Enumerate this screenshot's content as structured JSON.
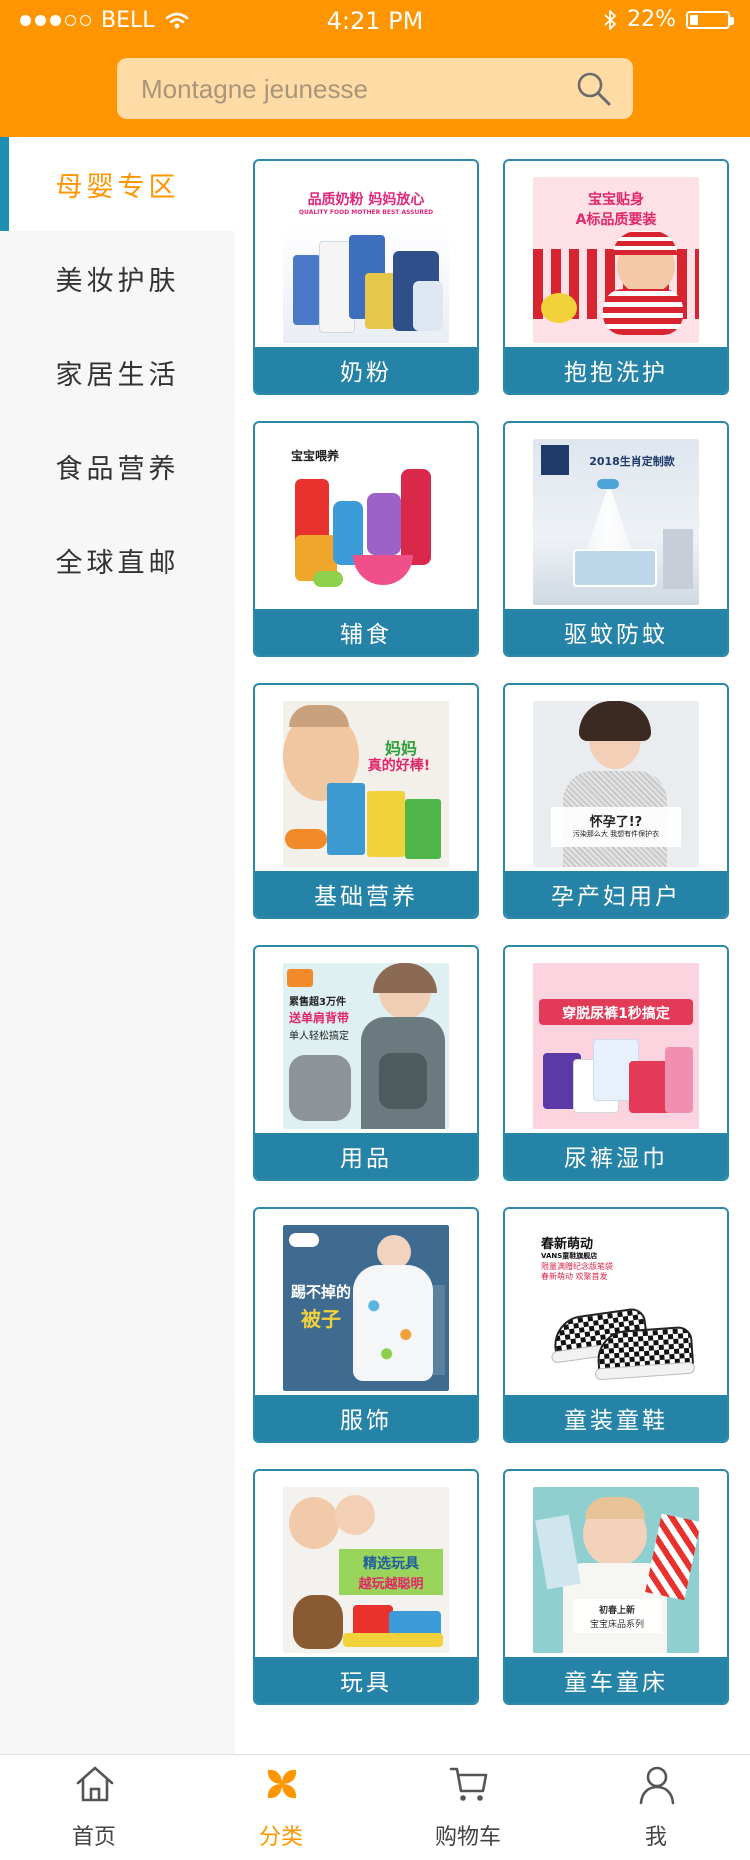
{
  "status_bar": {
    "carrier": "BELL",
    "time": "4:21 PM",
    "battery": "22%",
    "battery_level": 0.22
  },
  "search": {
    "placeholder": "Montagne jeunesse",
    "icon": "search-icon"
  },
  "sidebar": {
    "items": [
      {
        "label": "母婴专区",
        "active": true
      },
      {
        "label": "美妆护肤",
        "active": false
      },
      {
        "label": "家居生活",
        "active": false
      },
      {
        "label": "食品营养",
        "active": false
      },
      {
        "label": "全球直邮",
        "active": false
      }
    ]
  },
  "categories": [
    {
      "label": "奶粉",
      "img_text": [
        "品质奶粉 妈妈放心",
        "QUALITY FOOD MOTHER BEST ASSURED"
      ]
    },
    {
      "label": "抱抱洗护",
      "img_text": [
        "宝宝贴身",
        "A标品质要装"
      ]
    },
    {
      "label": "辅食",
      "img_text": [
        "宝宝喂养"
      ]
    },
    {
      "label": "驱蚊防蚊",
      "img_text": [
        "2018生肖定制款"
      ]
    },
    {
      "label": "基础营养",
      "img_text": [
        "妈妈",
        "真的好棒!"
      ]
    },
    {
      "label": "孕产妇用户",
      "img_text": [
        "怀孕了!?",
        "污染那么大 我想有件保护衣"
      ]
    },
    {
      "label": "用品",
      "img_text": [
        "累售超3万件",
        "送单肩背带",
        "单人轻松搞定"
      ]
    },
    {
      "label": "尿裤湿巾",
      "img_text": [
        "穿脱尿裤1秒搞定"
      ]
    },
    {
      "label": "服饰",
      "img_text": [
        "踢不掉的",
        "被子"
      ]
    },
    {
      "label": "童装童鞋",
      "img_text": [
        "春新萌动",
        "VANS童鞋旗舰店",
        "限量满赠纪念版笔袋",
        "春新萌动 欢聚首发"
      ]
    },
    {
      "label": "玩具",
      "img_text": [
        "精选玩具",
        "越玩越聪明"
      ]
    },
    {
      "label": "童车童床",
      "img_text": [
        "初春上新",
        "宝宝床品系列"
      ]
    }
  ],
  "tabbar": {
    "items": [
      {
        "label": "首页",
        "icon": "home-icon",
        "active": false
      },
      {
        "label": "分类",
        "icon": "category-icon",
        "active": true
      },
      {
        "label": "购物车",
        "icon": "cart-icon",
        "active": false
      },
      {
        "label": "我",
        "icon": "user-icon",
        "active": false
      }
    ]
  },
  "colors": {
    "brand": "#ff9500",
    "card_border": "#2b8aaa",
    "card_label_bg": "#2683a8",
    "search_bg": "#ffdca6"
  }
}
